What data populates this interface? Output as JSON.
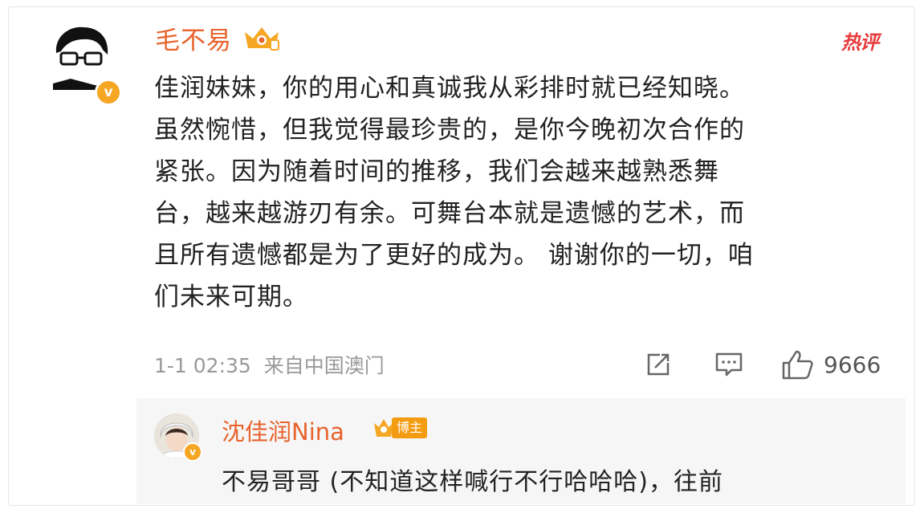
{
  "comment": {
    "username": "毛不易",
    "hot_label": "热评",
    "verified_mark": "v",
    "text_lines": [
      "佳润妹妹，你的用心和真诚我从彩排时就已经知晓。",
      "虽然惋惜，但我觉得最珍贵的，是你今晚初次合作的",
      "紧张。因为随着时间的推移，我们会越来越熟悉舞",
      "台，越来越游刃有余。可舞台本就是遗憾的艺术，而",
      "且所有遗憾都是为了更好的成为。 谢谢你的一切，咱",
      "们未来可期。"
    ],
    "timestamp": "1-1 02:35",
    "location": "来自中国澳门",
    "like_count": "9666"
  },
  "reply": {
    "username": "沈佳润Nina",
    "badge_label": "博主",
    "verified_mark": "v",
    "text": "不易哥哥 (不知道这样喊行不行哈哈哈)，往前"
  },
  "icons": {
    "share": "share-icon",
    "comment": "comment-icon",
    "like": "thumbs-up-icon"
  },
  "colors": {
    "username": "#e8632d",
    "hot": "#e63c3c",
    "verified": "#f5a623",
    "meta": "#999999"
  }
}
